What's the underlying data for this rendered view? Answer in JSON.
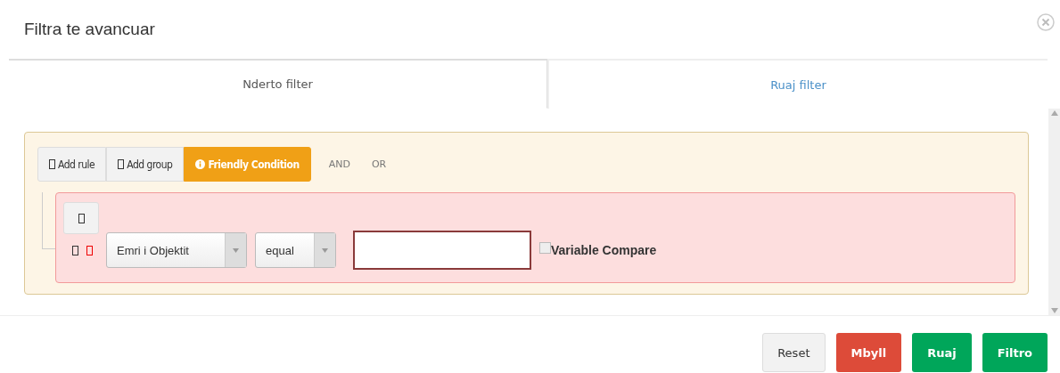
{
  "dialog": {
    "title": "Filtra te avancuar"
  },
  "tabs": [
    {
      "label": "Nderto filter",
      "selected": true
    },
    {
      "label": "Ruaj filter",
      "selected": false
    }
  ],
  "group": {
    "actions": [
      {
        "label": "Add rule",
        "kind": "plain"
      },
      {
        "label": "Add group",
        "kind": "plain"
      },
      {
        "label": "Friendly Condition",
        "kind": "warning"
      }
    ],
    "conditions": [
      {
        "label": "AND"
      },
      {
        "label": "OR"
      }
    ],
    "rules": [
      {
        "field": "Emri i Objektit",
        "operator": "equal",
        "variable_compare": {
          "label": "Variable Compare",
          "checked": false
        }
      }
    ]
  },
  "buttons": [
    {
      "label": "Reset",
      "kind": "default"
    },
    {
      "label": "Mbyll",
      "kind": "danger"
    },
    {
      "label": "Ruaj",
      "kind": "success"
    },
    {
      "label": "Filtro",
      "kind": "success"
    }
  ]
}
